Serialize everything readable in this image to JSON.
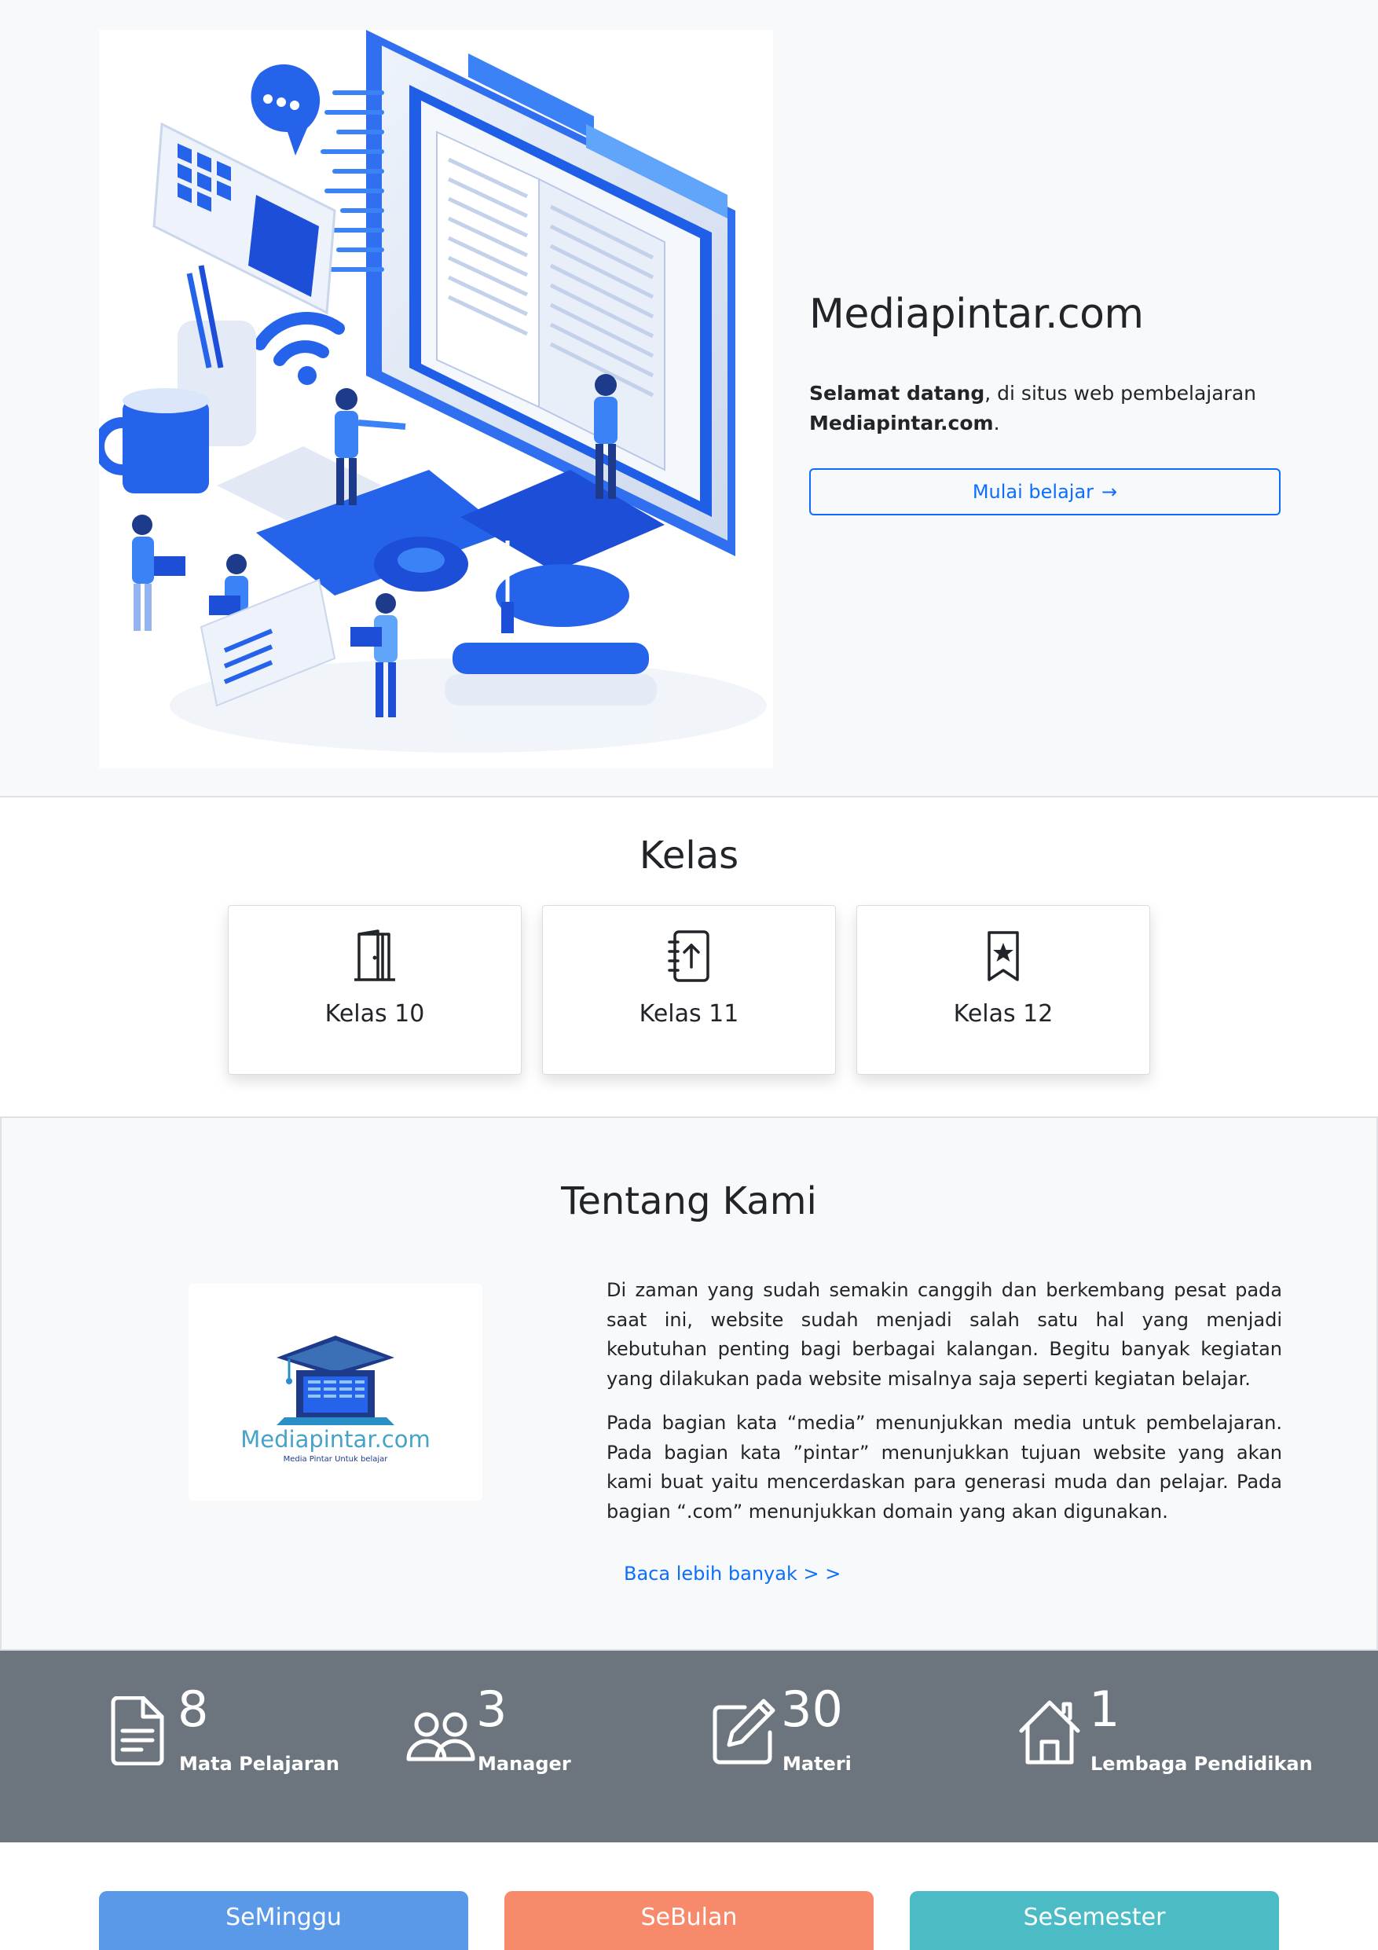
{
  "hero": {
    "title": "Mediapintar.com",
    "lead_bold_1": "Selamat datang",
    "lead_text_1": ", di situs web pembelajaran ",
    "lead_bold_2": "Mediapintar.com",
    "lead_text_2": ".",
    "cta_label": "Mulai belajar",
    "cta_arrow": "→",
    "illustration": "isometric-e-learning-illustration"
  },
  "kelas": {
    "title": "Kelas",
    "cards": [
      {
        "label": "Kelas 10",
        "icon": "door-icon"
      },
      {
        "label": "Kelas 11",
        "icon": "journal-arrow-up-icon"
      },
      {
        "label": "Kelas 12",
        "icon": "bookmark-star-icon"
      }
    ]
  },
  "about": {
    "title": "Tentang Kami",
    "paragraph_1": "Di zaman yang sudah semakin canggih dan berkembang pesat pada saat ini, website sudah menjadi salah satu hal yang menjadi kebutuhan penting bagi berbagai kalangan. Begitu banyak kegiatan yang dilakukan pada website misalnya saja seperti kegiatan belajar.",
    "paragraph_2": "Pada bagian kata “media” menunjukkan media untuk pembelajaran. Pada bagian kata ”pintar” menunjukkan tujuan website yang akan kami buat yaitu mencerdaskan para generasi muda dan pelajar. Pada bagian “.com” menunjukkan domain yang akan digunakan.",
    "read_more": "Baca lebih banyak > >",
    "logo_text": "Mediapintar.com",
    "logo_tagline": "Media Pintar Untuk belajar"
  },
  "stats": [
    {
      "value": "8",
      "label": "Mata Pelajaran",
      "icon": "file-text-icon"
    },
    {
      "value": "3",
      "label": "Manager",
      "icon": "people-icon"
    },
    {
      "value": "30",
      "label": "Materi",
      "icon": "pencil-square-icon"
    },
    {
      "value": "1",
      "label": "Lembaga Pendidikan",
      "icon": "house-icon"
    }
  ],
  "periods": [
    {
      "label": "SeMinggu",
      "color": "#5a98e8"
    },
    {
      "label": "SeBulan",
      "color": "#f88a6c"
    },
    {
      "label": "SeSemester",
      "color": "#4bbbc6"
    }
  ],
  "colors": {
    "primary": "#0d6efd",
    "light_bg": "#f8f9fa",
    "stats_bg": "#6c757d"
  }
}
